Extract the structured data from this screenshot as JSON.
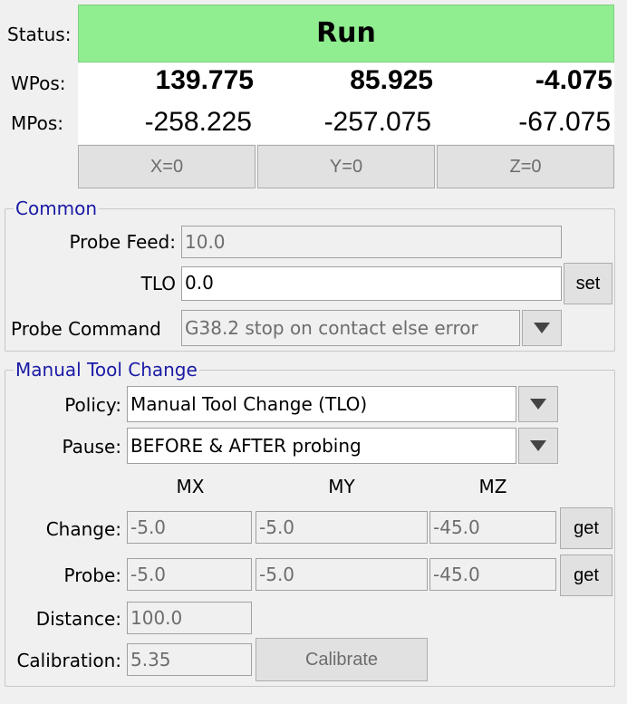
{
  "status": {
    "label": "Status:",
    "value": "Run",
    "color": "#90ee90"
  },
  "position": {
    "wpos_label": "WPos:",
    "mpos_label": "MPos:",
    "wpos": [
      "139.775",
      "85.925",
      "-4.075"
    ],
    "mpos": [
      "-258.225",
      "-257.075",
      "-67.075"
    ],
    "zero_buttons": [
      "X=0",
      "Y=0",
      "Z=0"
    ]
  },
  "common": {
    "title": "Common",
    "probe_feed_label": "Probe Feed:",
    "probe_feed_value": "10.0",
    "tlo_label": "TLO",
    "tlo_value": "0.0",
    "set_label": "set",
    "probe_command_label": "Probe Command",
    "probe_command_value": "G38.2 stop on contact else error"
  },
  "manual_tool_change": {
    "title": "Manual Tool Change",
    "policy_label": "Policy:",
    "policy_value": "Manual Tool Change (TLO)",
    "pause_label": "Pause:",
    "pause_value": "BEFORE & AFTER probing",
    "col_headers": [
      "MX",
      "MY",
      "MZ"
    ],
    "change_label": "Change:",
    "change_values": [
      "-5.0",
      "-5.0",
      "-45.0"
    ],
    "probe_label": "Probe:",
    "probe_values": [
      "-5.0",
      "-5.0",
      "-45.0"
    ],
    "get_label": "get",
    "distance_label": "Distance:",
    "distance_value": "100.0",
    "calibration_label": "Calibration:",
    "calibration_value": "5.35",
    "calibrate_label": "Calibrate"
  }
}
